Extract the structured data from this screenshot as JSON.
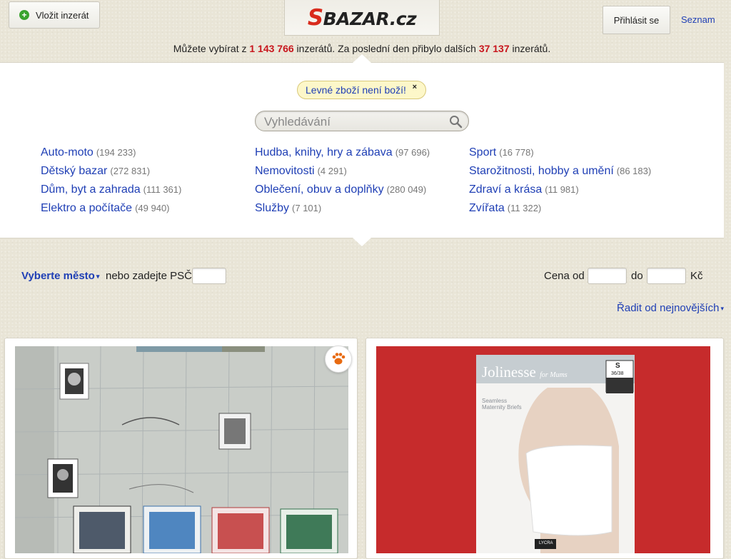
{
  "header": {
    "add_button_label": "Vložit inzerát",
    "logo_initial": "S",
    "logo_rest": "BAZAR.cz",
    "login_label": "Přihlásit se",
    "seznam_label": "Seznam"
  },
  "stats": {
    "prefix": "Můžete vybírat z",
    "total": "1 143 766",
    "mid": "inzerátů. Za poslední den přibylo dalších",
    "new": "37 137",
    "suffix": "inzerátů."
  },
  "promo": {
    "text": "Levné zboží není boží!",
    "close": "×"
  },
  "search": {
    "placeholder": "Vyhledávání"
  },
  "categories": [
    [
      {
        "name": "Auto-moto",
        "count": "(194 233)"
      },
      {
        "name": "Dětský bazar",
        "count": "(272 831)"
      },
      {
        "name": "Dům, byt a zahrada",
        "count": "(111 361)"
      },
      {
        "name": "Elektro a počítače",
        "count": "(49 940)"
      }
    ],
    [
      {
        "name": "Hudba, knihy, hry a zábava",
        "count": "(97 696)"
      },
      {
        "name": "Nemovitosti",
        "count": "(4 291)"
      },
      {
        "name": "Oblečení, obuv a doplňky",
        "count": "(280 049)"
      },
      {
        "name": "Služby",
        "count": "(7 101)"
      }
    ],
    [
      {
        "name": "Sport",
        "count": "(16 778)"
      },
      {
        "name": "Starožitnosti, hobby a umění",
        "count": "(86 183)"
      },
      {
        "name": "Zdraví a krása",
        "count": "(11 981)"
      },
      {
        "name": "Zvířata",
        "count": "(11 322)"
      }
    ]
  ],
  "filters": {
    "city_label": "Vyberte město",
    "city_arrow": "▾",
    "psc_label": "nebo zadejte PSČ",
    "price_from_label": "Cena od",
    "price_to_label": "do",
    "currency": "Kč",
    "sort_label": "Řadit od nejnovějších",
    "sort_arrow": "▾"
  },
  "listings": [
    {
      "image": "stamp-album-photo",
      "badge": "paw-icon"
    },
    {
      "image": "jolinesse-maternity-briefs-photo",
      "brand": "Jolinesse",
      "brand_sub": "for Mums",
      "size": "S",
      "size_sub": "36/38",
      "product": "Seamless Maternity Briefs",
      "lycra": "LYCRA"
    }
  ],
  "colors": {
    "link": "#1f3fb5",
    "stat_red": "#c8161d",
    "add_green": "#3aa32e",
    "logo_red": "#d92b1c",
    "promo_bg": "#fdf7c9"
  }
}
